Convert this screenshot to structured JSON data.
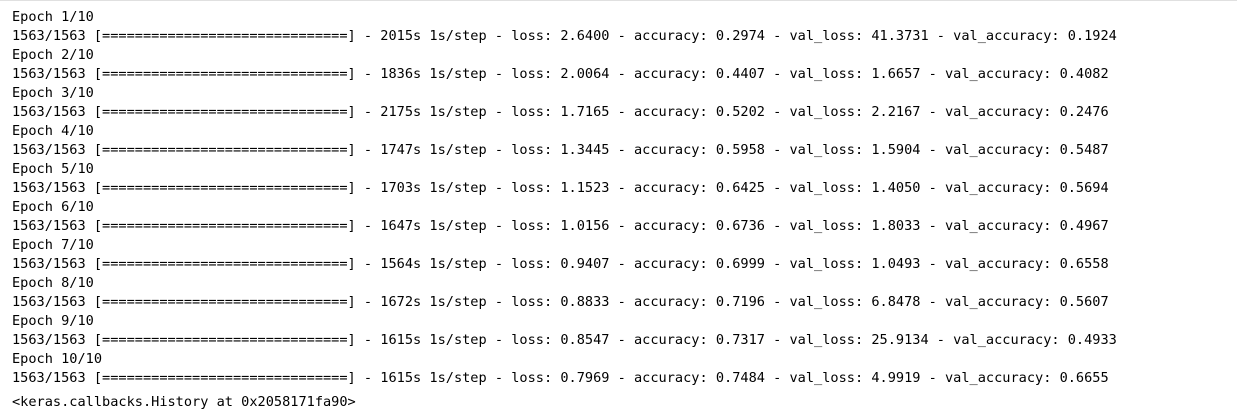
{
  "output": {
    "epochs": [
      {
        "header": "Epoch 1/10",
        "progress": "1563/1563 [==============================] - 2015s 1s/step - loss: 2.6400 - accuracy: 0.2974 - val_loss: 41.3731 - val_accuracy: 0.1924"
      },
      {
        "header": "Epoch 2/10",
        "progress": "1563/1563 [==============================] - 1836s 1s/step - loss: 2.0064 - accuracy: 0.4407 - val_loss: 1.6657 - val_accuracy: 0.4082"
      },
      {
        "header": "Epoch 3/10",
        "progress": "1563/1563 [==============================] - 2175s 1s/step - loss: 1.7165 - accuracy: 0.5202 - val_loss: 2.2167 - val_accuracy: 0.2476"
      },
      {
        "header": "Epoch 4/10",
        "progress": "1563/1563 [==============================] - 1747s 1s/step - loss: 1.3445 - accuracy: 0.5958 - val_loss: 1.5904 - val_accuracy: 0.5487"
      },
      {
        "header": "Epoch 5/10",
        "progress": "1563/1563 [==============================] - 1703s 1s/step - loss: 1.1523 - accuracy: 0.6425 - val_loss: 1.4050 - val_accuracy: 0.5694"
      },
      {
        "header": "Epoch 6/10",
        "progress": "1563/1563 [==============================] - 1647s 1s/step - loss: 1.0156 - accuracy: 0.6736 - val_loss: 1.8033 - val_accuracy: 0.4967"
      },
      {
        "header": "Epoch 7/10",
        "progress": "1563/1563 [==============================] - 1564s 1s/step - loss: 0.9407 - accuracy: 0.6999 - val_loss: 1.0493 - val_accuracy: 0.6558"
      },
      {
        "header": "Epoch 8/10",
        "progress": "1563/1563 [==============================] - 1672s 1s/step - loss: 0.8833 - accuracy: 0.7196 - val_loss: 6.8478 - val_accuracy: 0.5607"
      },
      {
        "header": "Epoch 9/10",
        "progress": "1563/1563 [==============================] - 1615s 1s/step - loss: 0.8547 - accuracy: 0.7317 - val_loss: 25.9134 - val_accuracy: 0.4933"
      },
      {
        "header": "Epoch 10/10",
        "progress": "1563/1563 [==============================] - 1615s 1s/step - loss: 0.7969 - accuracy: 0.7484 - val_loss: 4.9919 - val_accuracy: 0.6655"
      }
    ],
    "result": "<keras.callbacks.History at 0x2058171fa90>"
  }
}
